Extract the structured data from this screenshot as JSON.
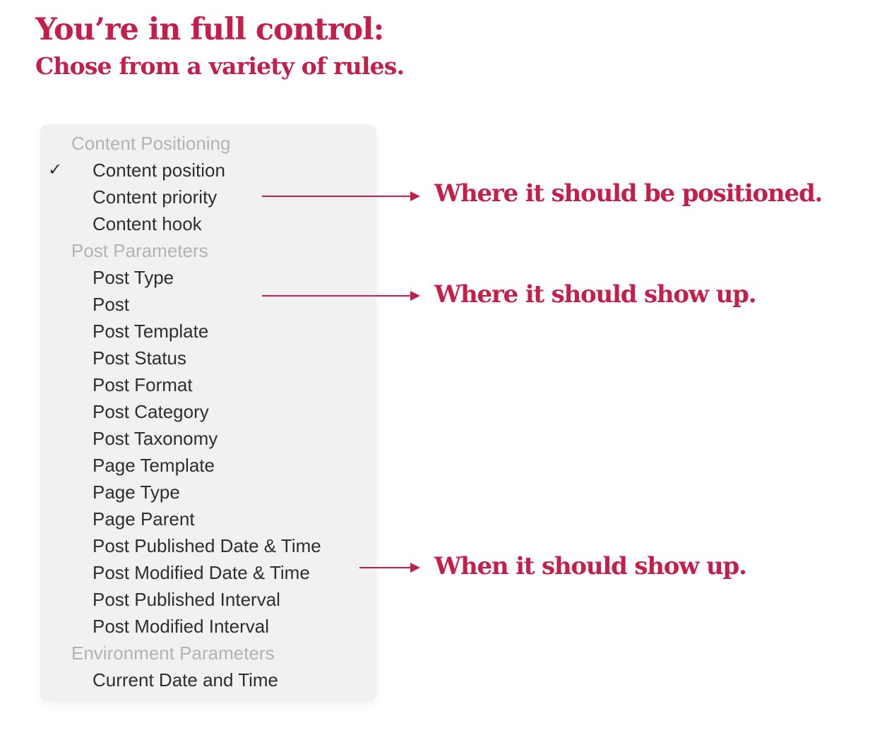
{
  "heading": {
    "title": "You’re in full control:",
    "subtitle": "Chose from a variety of rules."
  },
  "menu": {
    "selected": "Content position",
    "rows": [
      {
        "type": "header",
        "label": "Content Positioning"
      },
      {
        "type": "item",
        "label": "Content position",
        "checked": true
      },
      {
        "type": "item",
        "label": "Content priority"
      },
      {
        "type": "item",
        "label": "Content hook"
      },
      {
        "type": "header",
        "label": "Post Parameters"
      },
      {
        "type": "item",
        "label": "Post Type"
      },
      {
        "type": "item",
        "label": "Post"
      },
      {
        "type": "item",
        "label": "Post Template"
      },
      {
        "type": "item",
        "label": "Post Status"
      },
      {
        "type": "item",
        "label": "Post Format"
      },
      {
        "type": "item",
        "label": "Post Category"
      },
      {
        "type": "item",
        "label": "Post Taxonomy"
      },
      {
        "type": "item",
        "label": "Page Template"
      },
      {
        "type": "item",
        "label": "Page Type"
      },
      {
        "type": "item",
        "label": "Page Parent"
      },
      {
        "type": "item",
        "label": "Post Published Date & Time"
      },
      {
        "type": "item",
        "label": "Post Modified Date & Time"
      },
      {
        "type": "item",
        "label": "Post Published Interval"
      },
      {
        "type": "item",
        "label": "Post Modified Interval"
      },
      {
        "type": "header",
        "label": "Environment Parameters"
      },
      {
        "type": "item",
        "label": "Current Date and Time"
      }
    ],
    "check_icon": "✓"
  },
  "annotations": [
    {
      "text": "Where it should be positioned.",
      "points_to": "Content priority"
    },
    {
      "text": "Where it should show up.",
      "points_to": "Post"
    },
    {
      "text": "When it should show up.",
      "points_to": "Post Modified Date & Time"
    }
  ],
  "colors": {
    "accent": "#c41e4a",
    "menu_bg": "#f1f1f1",
    "header_text": "#b3b3b3",
    "item_text": "#2e2e2e"
  }
}
